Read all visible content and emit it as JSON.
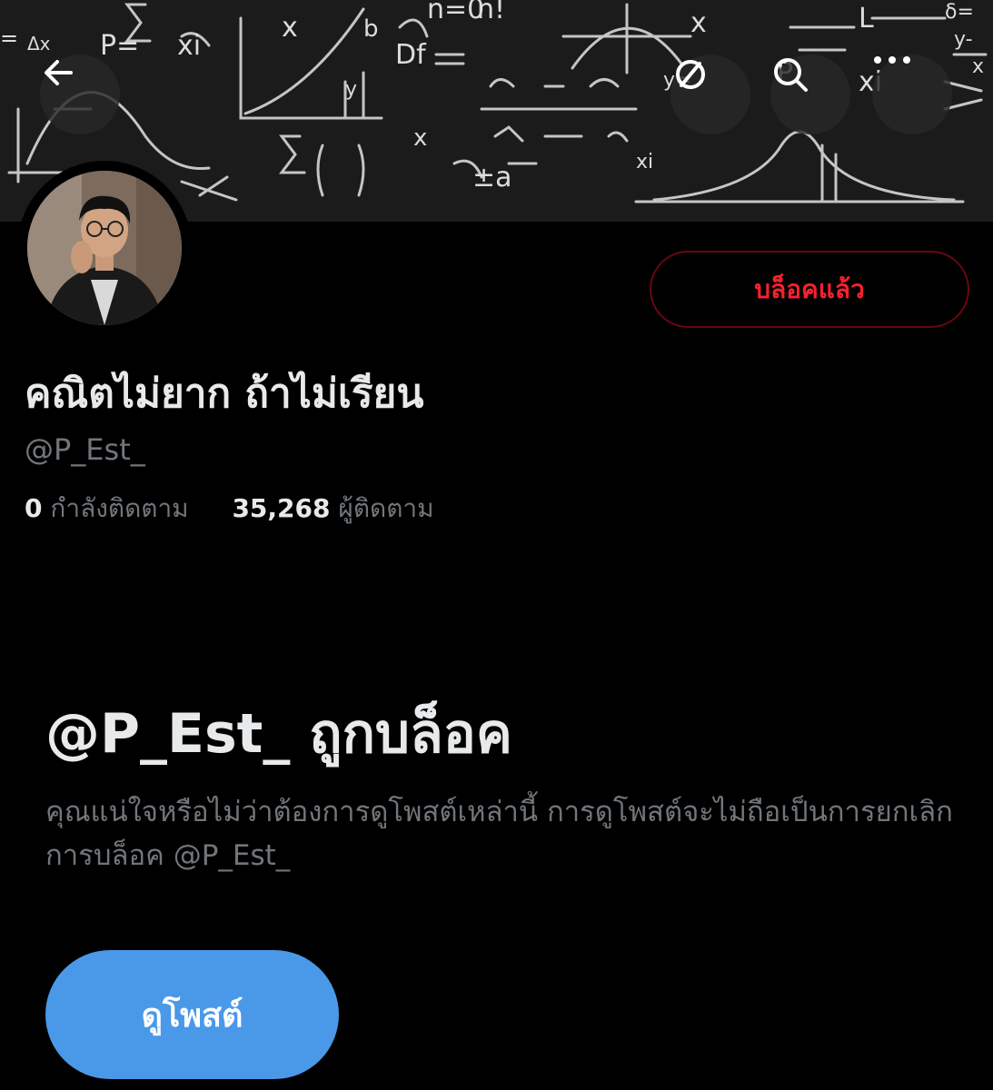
{
  "header": {
    "back_icon": "arrow-left-icon",
    "icons": [
      "no-notifications-icon",
      "search-icon",
      "more-icon"
    ]
  },
  "profile": {
    "display_name": "คณิตไม่ยาก ถ้าไม่เรียน",
    "handle": "@P_Est_",
    "following_count": "0",
    "following_label": "กำลังติดตาม",
    "followers_count": "35,268",
    "followers_label": "ผู้ติดตาม",
    "blocked_button_label": "บล็อคแล้ว"
  },
  "block_notice": {
    "title": "@P_Est_ ถูกบล็อค",
    "description": "คุณแน่ใจหรือไม่ว่าต้องการดูโพสต์เหล่านี้ การดูโพสต์จะไม่ถือเป็นการยกเลิกการบล็อค @P_Est_",
    "view_posts_label": "ดูโพสต์"
  },
  "colors": {
    "background": "#000000",
    "blocked_red": "#f4212e",
    "blocked_border": "#67070f",
    "primary_blue": "#4a99e9",
    "secondary_text": "#71767b"
  }
}
